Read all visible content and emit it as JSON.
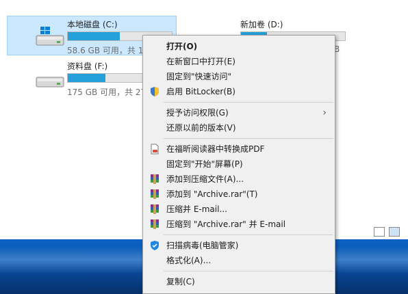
{
  "drives": [
    {
      "name": "本地磁盘 (C:)",
      "info": "58.6 GB 可用，共 1",
      "used_fraction": 0.5,
      "selected": true,
      "windows_logo": true
    },
    {
      "name": "新加卷 (D:)",
      "info": "B",
      "used_fraction": 0.25,
      "selected": false
    },
    {
      "name": "资料盘 (F:)",
      "info": "175 GB 可用，共 27",
      "used_fraction": 0.36,
      "selected": false
    }
  ],
  "menu": {
    "items": [
      {
        "label": "打开(O)",
        "bold": true
      },
      {
        "label": "在新窗口中打开(E)"
      },
      {
        "label": "固定到\"快速访问\""
      },
      {
        "label": "启用 BitLocker(B)",
        "icon": "shield-icon"
      },
      {
        "label": "授予访问权限(G)",
        "submenu": true
      },
      {
        "label": "还原以前的版本(V)"
      },
      {
        "label": "在福昕阅读器中转换成PDF",
        "icon": "pdf-convert-icon"
      },
      {
        "label": "固定到\"开始\"屏幕(P)"
      },
      {
        "label": "添加到压缩文件(A)...",
        "icon": "winrar-icon"
      },
      {
        "label": "添加到 \"Archive.rar\"(T)",
        "icon": "winrar-icon"
      },
      {
        "label": "压缩并 E-mail...",
        "icon": "winrar-icon"
      },
      {
        "label": "压缩到 \"Archive.rar\" 并 E-mail",
        "icon": "winrar-icon"
      },
      {
        "label": "扫描病毒(电脑管家)",
        "icon": "tencent-shield-icon"
      },
      {
        "label": "格式化(A)..."
      },
      {
        "label": "复制(C)"
      }
    ],
    "submenu_glyph": "›"
  },
  "colors": {
    "selection": "#cce8ff",
    "bar_fill": "#26a0da",
    "desktop": "#0a4fa6"
  }
}
